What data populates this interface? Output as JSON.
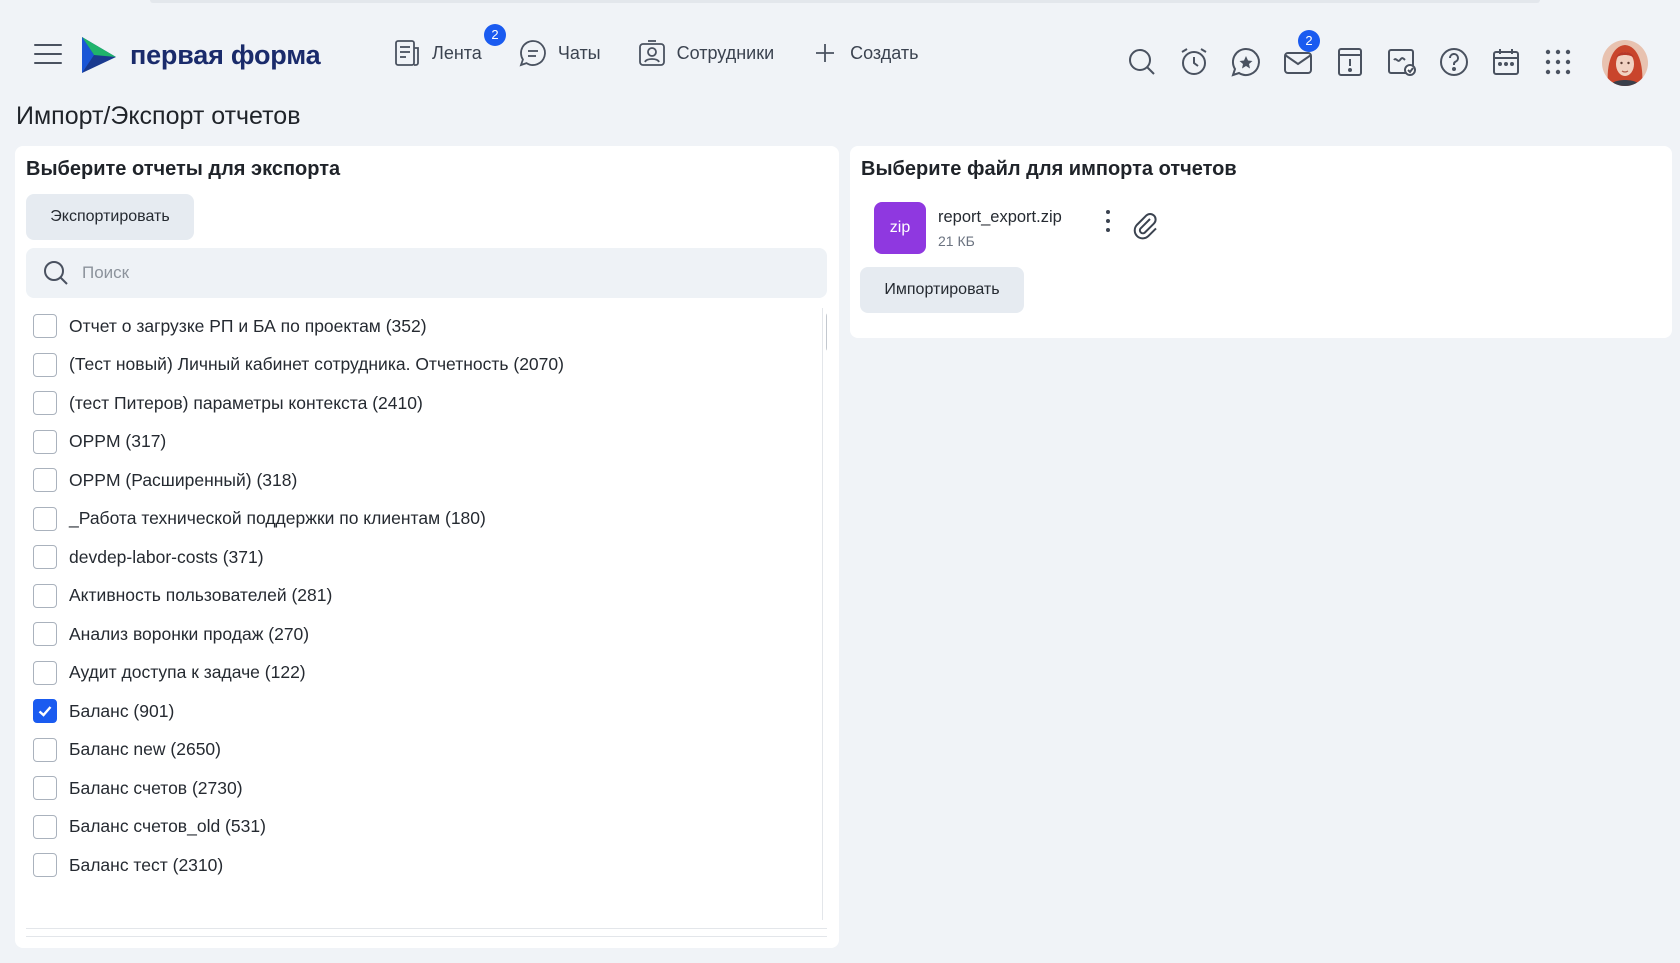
{
  "header": {
    "logo_text": "первая форма",
    "nav": [
      {
        "label": "Лента",
        "badge": "2"
      },
      {
        "label": "Чаты"
      },
      {
        "label": "Сотрудники"
      },
      {
        "label": "Создать"
      }
    ],
    "mail_badge": "2"
  },
  "page_title": "Импорт/Экспорт отчетов",
  "export_panel": {
    "heading": "Выберите отчеты для экспорта",
    "export_button": "Экспортировать",
    "search_placeholder": "Поиск",
    "items": [
      {
        "label": "Отчет о загрузке РП и БА по проектам (352)",
        "checked": false
      },
      {
        "label": "(Тест новый) Личный кабинет сотрудника. Отчетность (2070)",
        "checked": false
      },
      {
        "label": "(тест Питеров) параметры контекста (2410)",
        "checked": false
      },
      {
        "label": "OPPM (317)",
        "checked": false
      },
      {
        "label": "OPPM (Расширенный) (318)",
        "checked": false
      },
      {
        "label": "_Работа технической поддержки по клиентам (180)",
        "checked": false
      },
      {
        "label": "devdep-labor-costs (371)",
        "checked": false
      },
      {
        "label": "Активность пользователей (281)",
        "checked": false
      },
      {
        "label": "Анализ воронки продаж (270)",
        "checked": false
      },
      {
        "label": "Аудит доступа к задаче (122)",
        "checked": false
      },
      {
        "label": "Баланс (901)",
        "checked": true
      },
      {
        "label": "Баланс new (2650)",
        "checked": false
      },
      {
        "label": "Баланс счетов (2730)",
        "checked": false
      },
      {
        "label": "Баланс счетов_old (531)",
        "checked": false
      },
      {
        "label": "Баланс тест (2310)",
        "checked": false
      }
    ]
  },
  "import_panel": {
    "heading": "Выберите файл для импорта отчетов",
    "file": {
      "type": "zip",
      "name": "report_export.zip",
      "size": "21 КБ"
    },
    "import_button": "Импортировать"
  },
  "colors": {
    "accent": "#1a5bf0",
    "file_icon": "#8f38e0",
    "logo_text": "#1a2b6b",
    "background": "#f0f3f7"
  }
}
